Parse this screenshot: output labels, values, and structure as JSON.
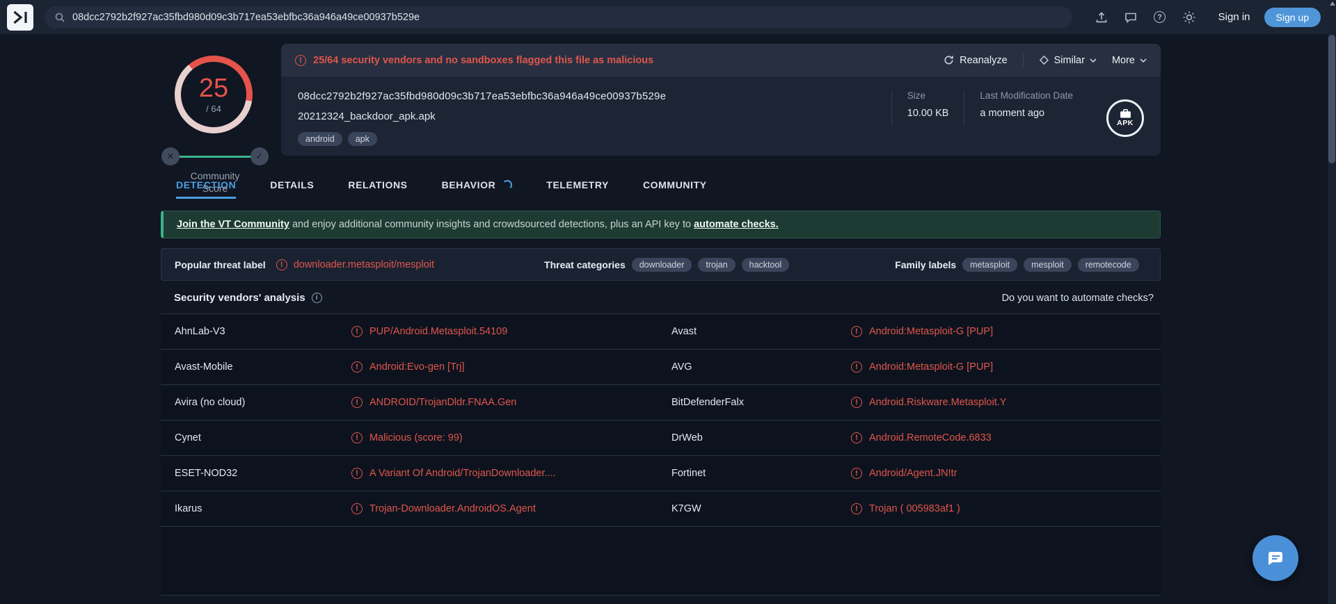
{
  "colors": {
    "accent_blue": "#4f96d8",
    "danger_red": "#e0564c",
    "community_green": "#3cb38c"
  },
  "icons": {
    "warning_glyph": "!",
    "info_glyph": "i",
    "help_glyph": "?",
    "cross_glyph": "✕",
    "check_glyph": "✓"
  },
  "topbar": {
    "search_value": "08dcc2792b2f927ac35fbd980d09c3b717ea53ebfbc36a946a49ce00937b529e",
    "sign_in_label": "Sign in",
    "sign_up_label": "Sign up"
  },
  "score_widget": {
    "detections": "25",
    "total": "/ 64",
    "community_label": "Community Score"
  },
  "file_card": {
    "warning_text": "25/64 security vendors and no sandboxes flagged this file as malicious",
    "actions": {
      "reanalyze": "Reanalyze",
      "similar": "Similar",
      "more": "More"
    },
    "hash": "08dcc2792b2f927ac35fbd980d09c3b717ea53ebfbc36a946a49ce00937b529e",
    "filename": "20212324_backdoor_apk.apk",
    "tags": [
      "android",
      "apk"
    ],
    "size": {
      "label": "Size",
      "value": "10.00 KB"
    },
    "last_modification": {
      "label": "Last Modification Date",
      "value": "a moment ago"
    },
    "file_type_badge": "APK"
  },
  "tabs": [
    {
      "label": "DETECTION",
      "active": true,
      "spinner": false
    },
    {
      "label": "DETAILS",
      "active": false,
      "spinner": false
    },
    {
      "label": "RELATIONS",
      "active": false,
      "spinner": false
    },
    {
      "label": "BEHAVIOR",
      "active": false,
      "spinner": true
    },
    {
      "label": "TELEMETRY",
      "active": false,
      "spinner": false
    },
    {
      "label": "COMMUNITY",
      "active": false,
      "spinner": false
    }
  ],
  "community_banner": {
    "link_join": "Join the VT Community",
    "middle_text": " and enjoy additional community insights and crowdsourced detections, plus an API key to ",
    "link_automate": "automate checks."
  },
  "threat_summary": {
    "popular_label": "Popular threat label",
    "popular_value": "downloader.metasploit/mesploit",
    "categories_label": "Threat categories",
    "categories": [
      "downloader",
      "trojan",
      "hacktool"
    ],
    "family_label": "Family labels",
    "families": [
      "metasploit",
      "mesploit",
      "remotecode"
    ]
  },
  "vendor_analysis": {
    "title": "Security vendors' analysis",
    "automate_question": "Do you want to automate checks?",
    "rows": [
      {
        "vendor1": "AhnLab-V3",
        "result1": "PUP/Android.Metasploit.54109",
        "vendor2": "Avast",
        "result2": "Android:Metasploit-G [PUP]"
      },
      {
        "vendor1": "Avast-Mobile",
        "result1": "Android:Evo-gen [Trj]",
        "vendor2": "AVG",
        "result2": "Android:Metasploit-G [PUP]"
      },
      {
        "vendor1": "Avira (no cloud)",
        "result1": "ANDROID/TrojanDldr.FNAA.Gen",
        "vendor2": "BitDefenderFalx",
        "result2": "Android.Riskware.Metasploit.Y"
      },
      {
        "vendor1": "Cynet",
        "result1": "Malicious (score: 99)",
        "vendor2": "DrWeb",
        "result2": "Android.RemoteCode.6833"
      },
      {
        "vendor1": "ESET-NOD32",
        "result1": "A Variant Of Android/TrojanDownloader....",
        "vendor2": "Fortinet",
        "result2": "Android/Agent.JN!tr"
      },
      {
        "vendor1": "Ikarus",
        "result1": "Trojan-Downloader.AndroidOS.Agent",
        "vendor2": "K7GW",
        "result2": "Trojan ( 005983af1 )"
      }
    ]
  }
}
